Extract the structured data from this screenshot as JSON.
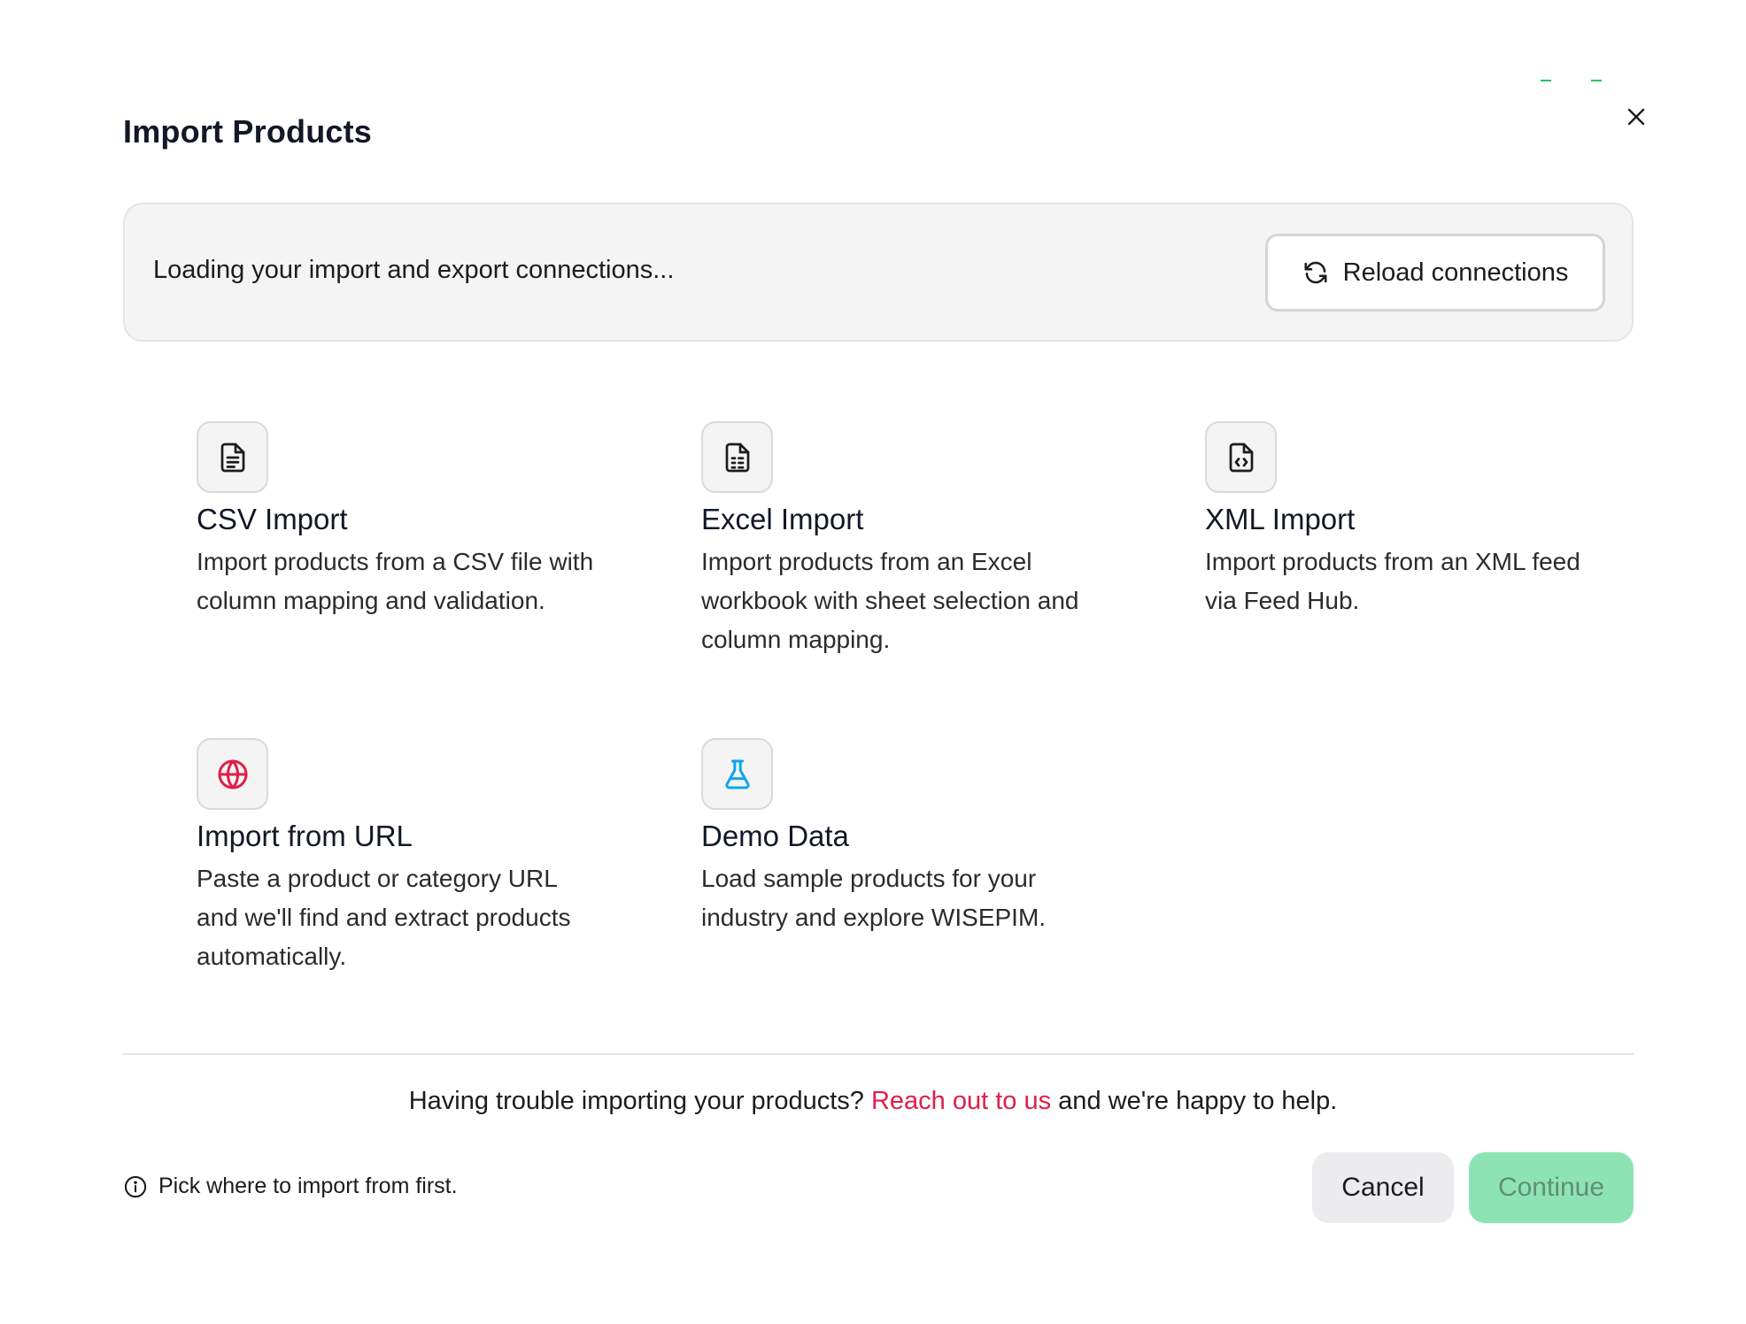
{
  "dialog": {
    "title": "Import Products",
    "close_icon": "close-icon"
  },
  "connections": {
    "loading_text": "Loading your import and export connections...",
    "reload_label": "Reload connections",
    "reload_icon": "refresh-icon"
  },
  "options": [
    {
      "title": "CSV Import",
      "description": "Import products from a CSV file with column mapping and validation.",
      "icon": "file-text-icon",
      "icon_color": "#1c1c1e"
    },
    {
      "title": "Excel Import",
      "description": "Import products from an Excel workbook with sheet selection and column mapping.",
      "icon": "spreadsheet-icon",
      "icon_color": "#1c1c1e"
    },
    {
      "title": "XML Import",
      "description": "Import products from an XML feed via Feed Hub.",
      "icon": "file-code-icon",
      "icon_color": "#1c1c1e"
    },
    {
      "title": "Import from URL",
      "description": "Paste a product or category URL and we'll find and extract products automatically.",
      "icon": "globe-icon",
      "icon_color": "#e11d48"
    },
    {
      "title": "Demo Data",
      "description": "Load sample products for your industry and explore WISEPIM.",
      "icon": "flask-icon",
      "icon_color": "#0ea5e9"
    }
  ],
  "footer": {
    "help_prefix": "Having trouble importing your products? ",
    "help_link": "Reach out to us",
    "help_suffix": " and we're happy to help.",
    "hint": "Pick where to import from first.",
    "hint_icon": "info-icon",
    "cancel_label": "Cancel",
    "continue_label": "Continue"
  },
  "colors": {
    "accent_link": "#e11d48",
    "continue_disabled": "#8de3b4",
    "brand_green": "#22c55e"
  }
}
